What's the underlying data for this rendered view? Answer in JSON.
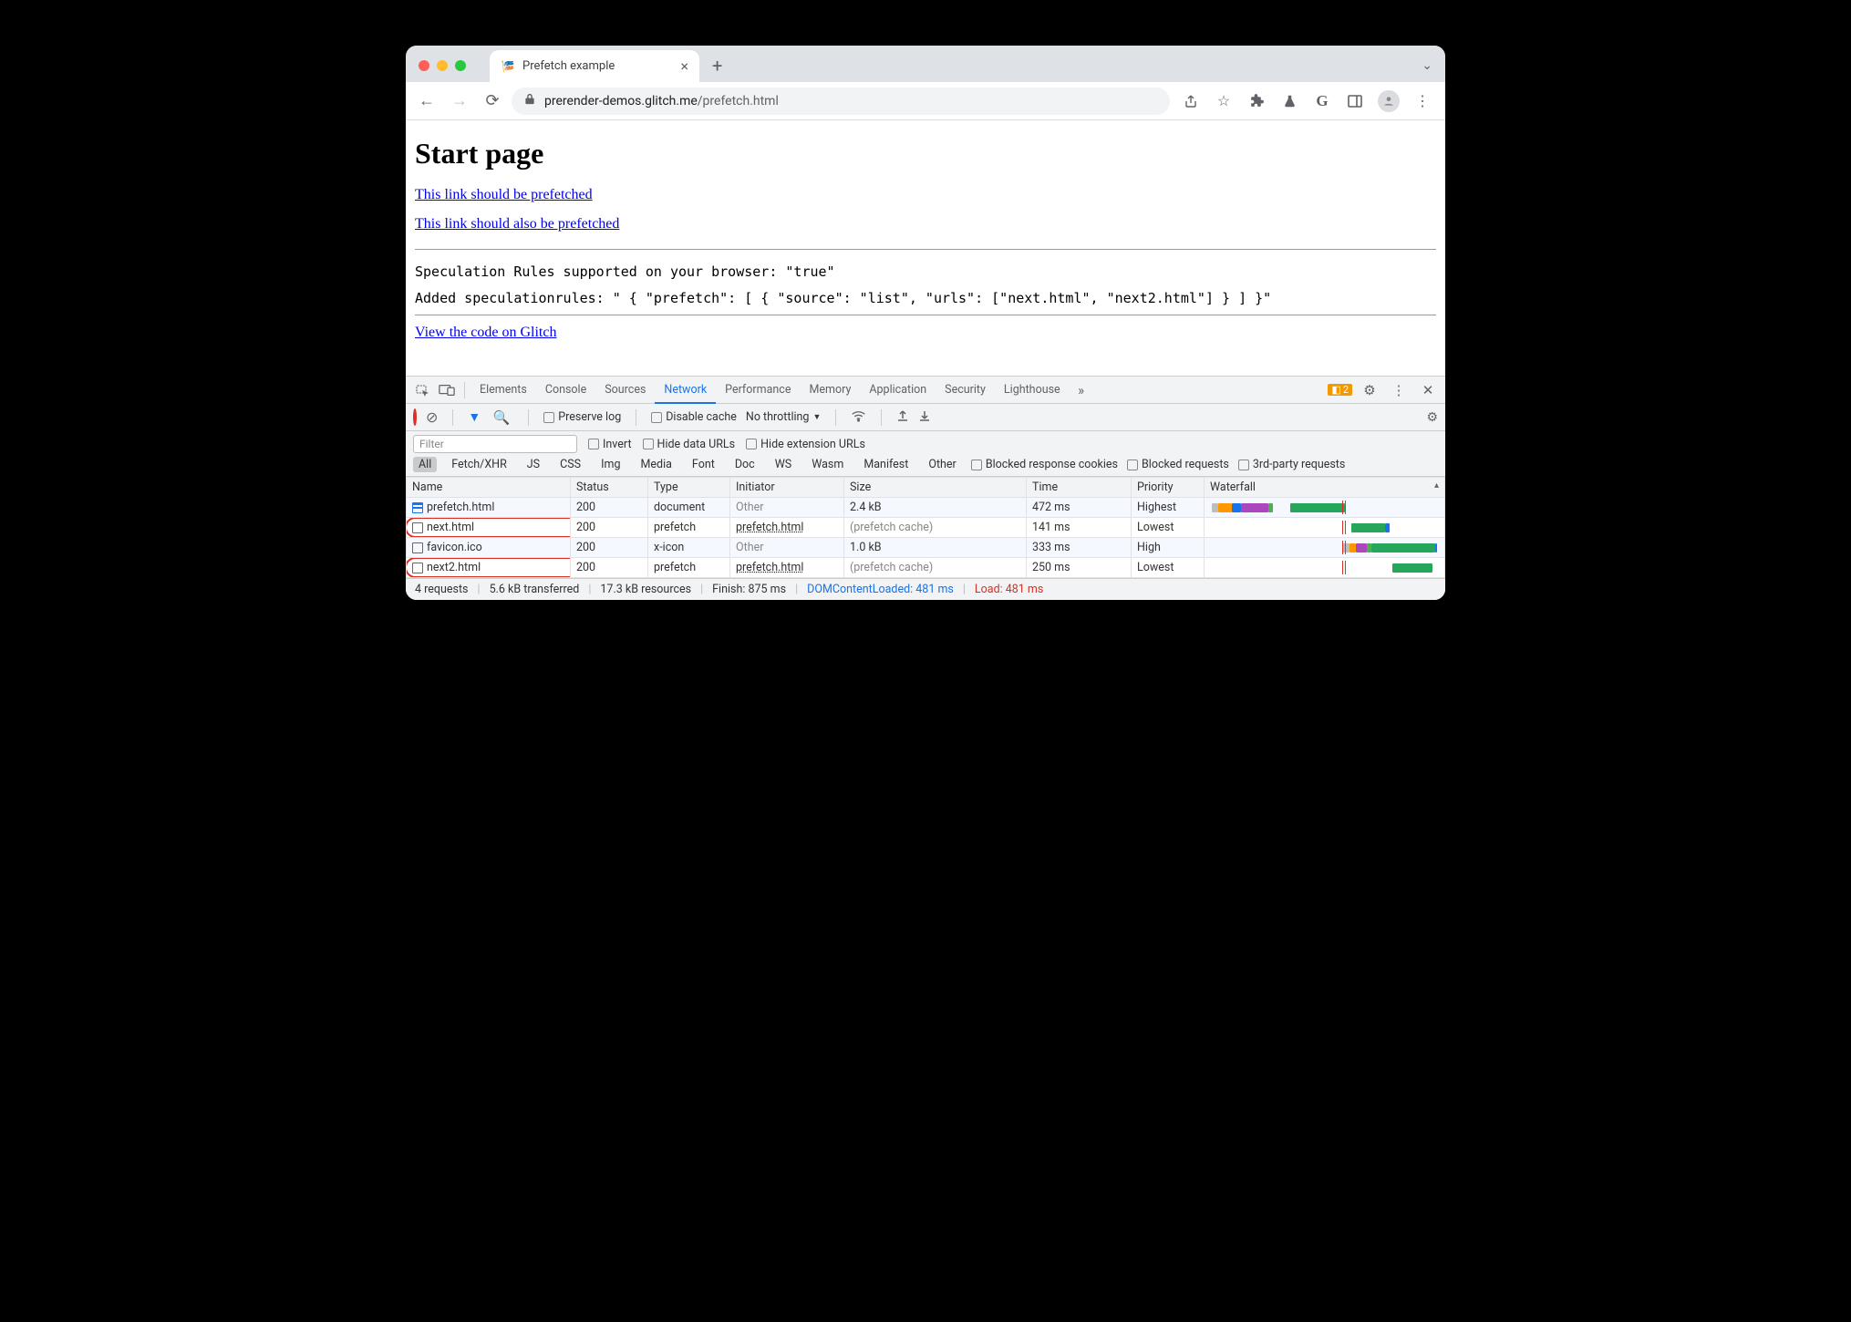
{
  "tab": {
    "title": "Prefetch example"
  },
  "url": {
    "host": "prerender-demos.glitch.me",
    "path": "/prefetch.html"
  },
  "page": {
    "h1": "Start page",
    "link1": "This link should be prefetched",
    "link2": "This link should also be prefetched",
    "mono1": "Speculation Rules supported on your browser: \"true\"",
    "mono2": "Added speculationrules: \" { \"prefetch\": [ { \"source\": \"list\", \"urls\": [\"next.html\", \"next2.html\"] } ] }\"",
    "link3": "View the code on Glitch"
  },
  "devtools": {
    "tabs": [
      "Elements",
      "Console",
      "Sources",
      "Network",
      "Performance",
      "Memory",
      "Application",
      "Security",
      "Lighthouse"
    ],
    "activeTab": "Network",
    "issues": "2",
    "preserve": "Preserve log",
    "disableCache": "Disable cache",
    "throttling": "No throttling",
    "filterPlaceholder": "Filter",
    "invert": "Invert",
    "hideData": "Hide data URLs",
    "hideExt": "Hide extension URLs",
    "types": [
      "All",
      "Fetch/XHR",
      "JS",
      "CSS",
      "Img",
      "Media",
      "Font",
      "Doc",
      "WS",
      "Wasm",
      "Manifest",
      "Other"
    ],
    "blockedCookies": "Blocked response cookies",
    "blockedReq": "Blocked requests",
    "thirdParty": "3rd-party requests",
    "cols": [
      "Name",
      "Status",
      "Type",
      "Initiator",
      "Size",
      "Time",
      "Priority",
      "Waterfall"
    ],
    "footer": {
      "requests": "4 requests",
      "transferred": "5.6 kB transferred",
      "resources": "17.3 kB resources",
      "finish": "Finish: 875 ms",
      "dcl": "DOMContentLoaded: 481 ms",
      "load": "Load: 481 ms"
    }
  },
  "rows": [
    {
      "name": "prefetch.html",
      "status": "200",
      "type": "document",
      "initiator": "Other",
      "initiatorLink": false,
      "size": "2.4 kB",
      "sizeCache": false,
      "time": "472 ms",
      "priority": "Highest",
      "highlight": false,
      "bars": [
        {
          "l": 0,
          "w": 3,
          "c": "#bdbdbd"
        },
        {
          "l": 3,
          "w": 6,
          "c": "#ff9800"
        },
        {
          "l": 9,
          "w": 4,
          "c": "#1a73e8"
        },
        {
          "l": 13,
          "w": 12,
          "c": "#ab47bc"
        },
        {
          "l": 25,
          "w": 2,
          "c": "#4caf50"
        },
        {
          "l": 35,
          "w": 24,
          "c": "#26a65b"
        }
      ],
      "iconBlue": true
    },
    {
      "name": "next.html",
      "status": "200",
      "type": "prefetch",
      "initiator": "prefetch.html",
      "initiatorLink": true,
      "size": "(prefetch cache)",
      "sizeCache": true,
      "time": "141 ms",
      "priority": "Lowest",
      "highlight": true,
      "bars": [
        {
          "l": 62,
          "w": 15,
          "c": "#26a65b"
        },
        {
          "l": 77,
          "w": 2,
          "c": "#1a73e8"
        }
      ],
      "iconBlue": false
    },
    {
      "name": "favicon.ico",
      "status": "200",
      "type": "x-icon",
      "initiator": "Other",
      "initiatorLink": false,
      "size": "1.0 kB",
      "sizeCache": false,
      "time": "333 ms",
      "priority": "High",
      "highlight": false,
      "bars": [
        {
          "l": 58,
          "w": 3,
          "c": "#bdbdbd"
        },
        {
          "l": 61,
          "w": 3,
          "c": "#ff9800"
        },
        {
          "l": 64,
          "w": 5,
          "c": "#ab47bc"
        },
        {
          "l": 69,
          "w": 2,
          "c": "#4caf50"
        },
        {
          "l": 71,
          "w": 28,
          "c": "#26a65b"
        },
        {
          "l": 99,
          "w": 1,
          "c": "#1a73e8"
        }
      ],
      "iconBlue": false
    },
    {
      "name": "next2.html",
      "status": "200",
      "type": "prefetch",
      "initiator": "prefetch.html",
      "initiatorLink": true,
      "size": "(prefetch cache)",
      "sizeCache": true,
      "time": "250 ms",
      "priority": "Lowest",
      "highlight": true,
      "bars": [
        {
          "l": 80,
          "w": 18,
          "c": "#26a65b"
        }
      ],
      "iconBlue": false
    }
  ],
  "waterfall": {
    "redLine": 58,
    "blueLine": 59
  }
}
